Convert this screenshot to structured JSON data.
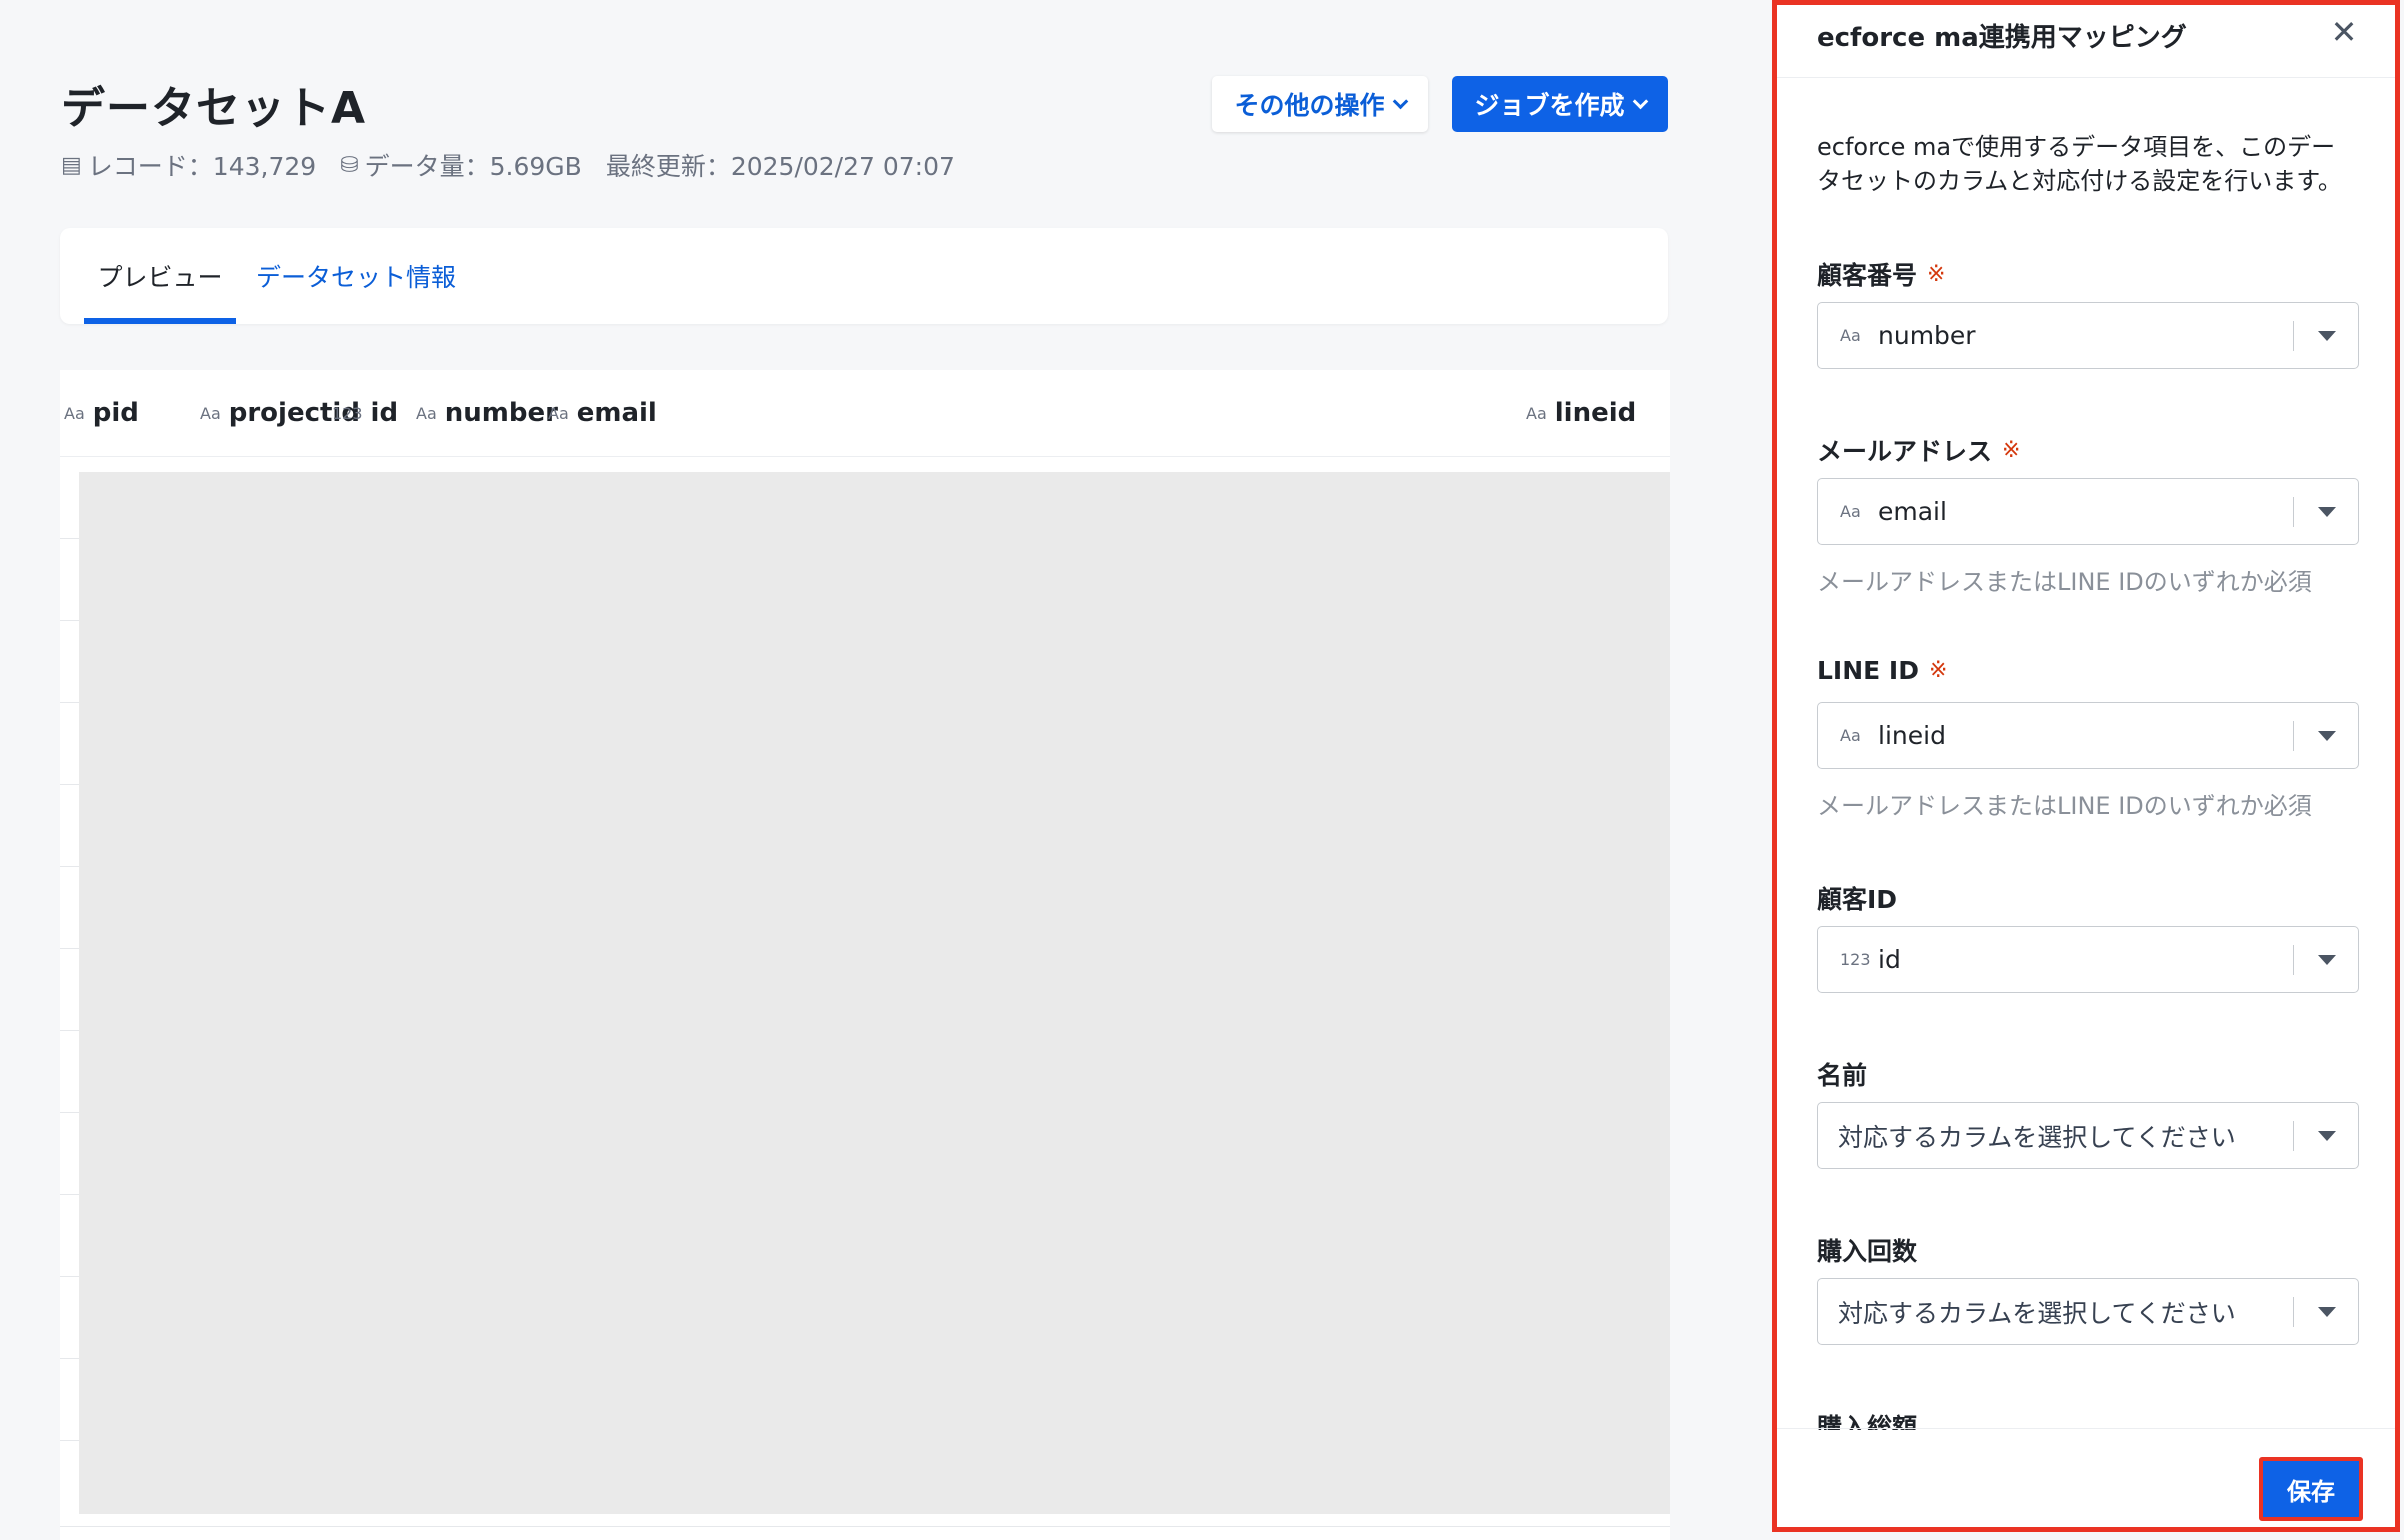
{
  "dataset": {
    "title": "データセットA",
    "records": "レコード：143,729",
    "size": "データ量：5.69GB",
    "updated": "最終更新：2025/02/27 07:07",
    "icons": [
      "table-icon",
      "database-icon"
    ]
  },
  "actions": {
    "other_label": "その他の操作",
    "create_job_label": "ジョブを作成"
  },
  "tabs": [
    {
      "label": "プレビュー",
      "active": true
    },
    {
      "label": "データセット情報",
      "active": false
    }
  ],
  "table": {
    "columns": [
      {
        "name": "pid",
        "type": "Aa"
      },
      {
        "name": "projectid",
        "type": "Aa"
      },
      {
        "name": "id",
        "type": "123"
      },
      {
        "name": "number",
        "type": "Aa"
      },
      {
        "name": "email",
        "type": "Aa"
      },
      {
        "name": "lineid",
        "type": "Aa"
      }
    ]
  },
  "panel": {
    "title": "ecforce ma連携用マッピング",
    "description": "ecforce maで使用するデータ項目を、このデータセットのカラムと対応付ける設定を行います。",
    "required_mark": "※",
    "fields": [
      {
        "label": "顧客番号",
        "required": true,
        "type": "Aa",
        "value": "number",
        "hint": ""
      },
      {
        "label": "メールアドレス",
        "required": true,
        "type": "Aa",
        "value": "email",
        "hint": "メールアドレスまたはLINE IDのいずれか必須"
      },
      {
        "label": "LINE ID",
        "required": true,
        "type": "Aa",
        "value": "lineid",
        "hint": "メールアドレスまたはLINE IDのいずれか必須"
      },
      {
        "label": "顧客ID",
        "required": false,
        "type": "123",
        "value": "id",
        "hint": ""
      },
      {
        "label": "名前",
        "required": false,
        "type": "",
        "value": "",
        "placeholder": "対応するカラムを選択してください",
        "hint": ""
      },
      {
        "label": "購入回数",
        "required": false,
        "type": "",
        "value": "",
        "placeholder": "対応するカラムを選択してください",
        "hint": ""
      },
      {
        "label": "購入総額",
        "required": false,
        "type": "",
        "value": "",
        "hint": ""
      }
    ],
    "save_label": "保存",
    "highlight_color": "#ea3323",
    "accent_color": "#0e62e6"
  }
}
